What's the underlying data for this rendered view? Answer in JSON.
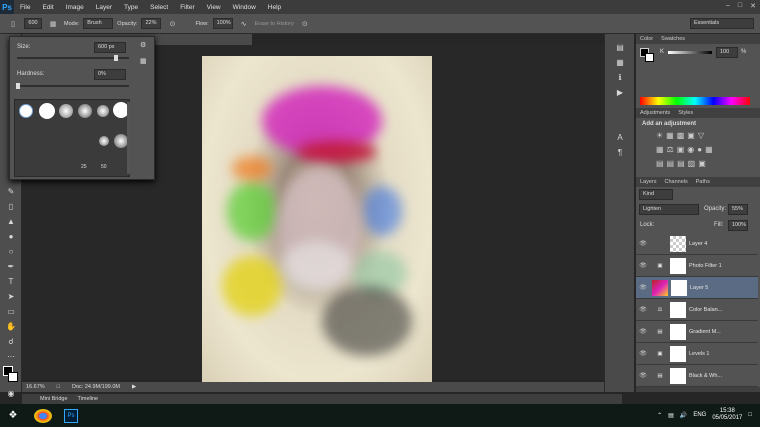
{
  "app": {
    "logo": "Ps"
  },
  "menu": [
    "File",
    "Edit",
    "Image",
    "Layer",
    "Type",
    "Select",
    "Filter",
    "View",
    "Window",
    "Help"
  ],
  "options": {
    "brush_size": "600",
    "mode_label": "Mode:",
    "mode_value": "Brush",
    "opacity_label": "Opacity:",
    "opacity_value": "22%",
    "flow_label": "Flow:",
    "flow_value": "100%",
    "erase_history": "Erase to History",
    "workspace": "Essentials"
  },
  "brush_panel": {
    "size_label": "Size:",
    "size_value": "600 px",
    "hardness_label": "Hardness:",
    "hardness_value": "0%",
    "preset_nums": [
      "25",
      "50"
    ]
  },
  "document": {
    "tab_title": "5.7% (Layer 5, Layer Mask/8) * ×",
    "zoom": "16.67%",
    "doc_size": "Doc: 24.9M/199.0M"
  },
  "bottom_tabs": [
    "Mini Bridge",
    "Timeline"
  ],
  "color_panel": {
    "tabs": [
      "Color",
      "Swatches"
    ],
    "k_label": "K",
    "k_value": "100",
    "pct": "%"
  },
  "adjustments": {
    "tabs": [
      "Adjustments",
      "Styles"
    ],
    "heading": "Add an adjustment"
  },
  "layers_panel": {
    "tabs": [
      "Layers",
      "Channels",
      "Paths"
    ],
    "kind": "Kind",
    "blend_mode": "Lighten",
    "opacity_label": "Opacity:",
    "opacity_value": "55%",
    "lock_label": "Lock:",
    "fill_label": "Fill:",
    "fill_value": "100%",
    "layers": [
      {
        "name": "Layer 4"
      },
      {
        "name": "Photo Filter 1"
      },
      {
        "name": "Layer 5"
      },
      {
        "name": "Color Balan..."
      },
      {
        "name": "Gradient M..."
      },
      {
        "name": "Levels 1"
      },
      {
        "name": "Black & Wh..."
      }
    ]
  },
  "taskbar": {
    "lang": "ENG",
    "time": "15:38",
    "date": "05/05/2017"
  }
}
